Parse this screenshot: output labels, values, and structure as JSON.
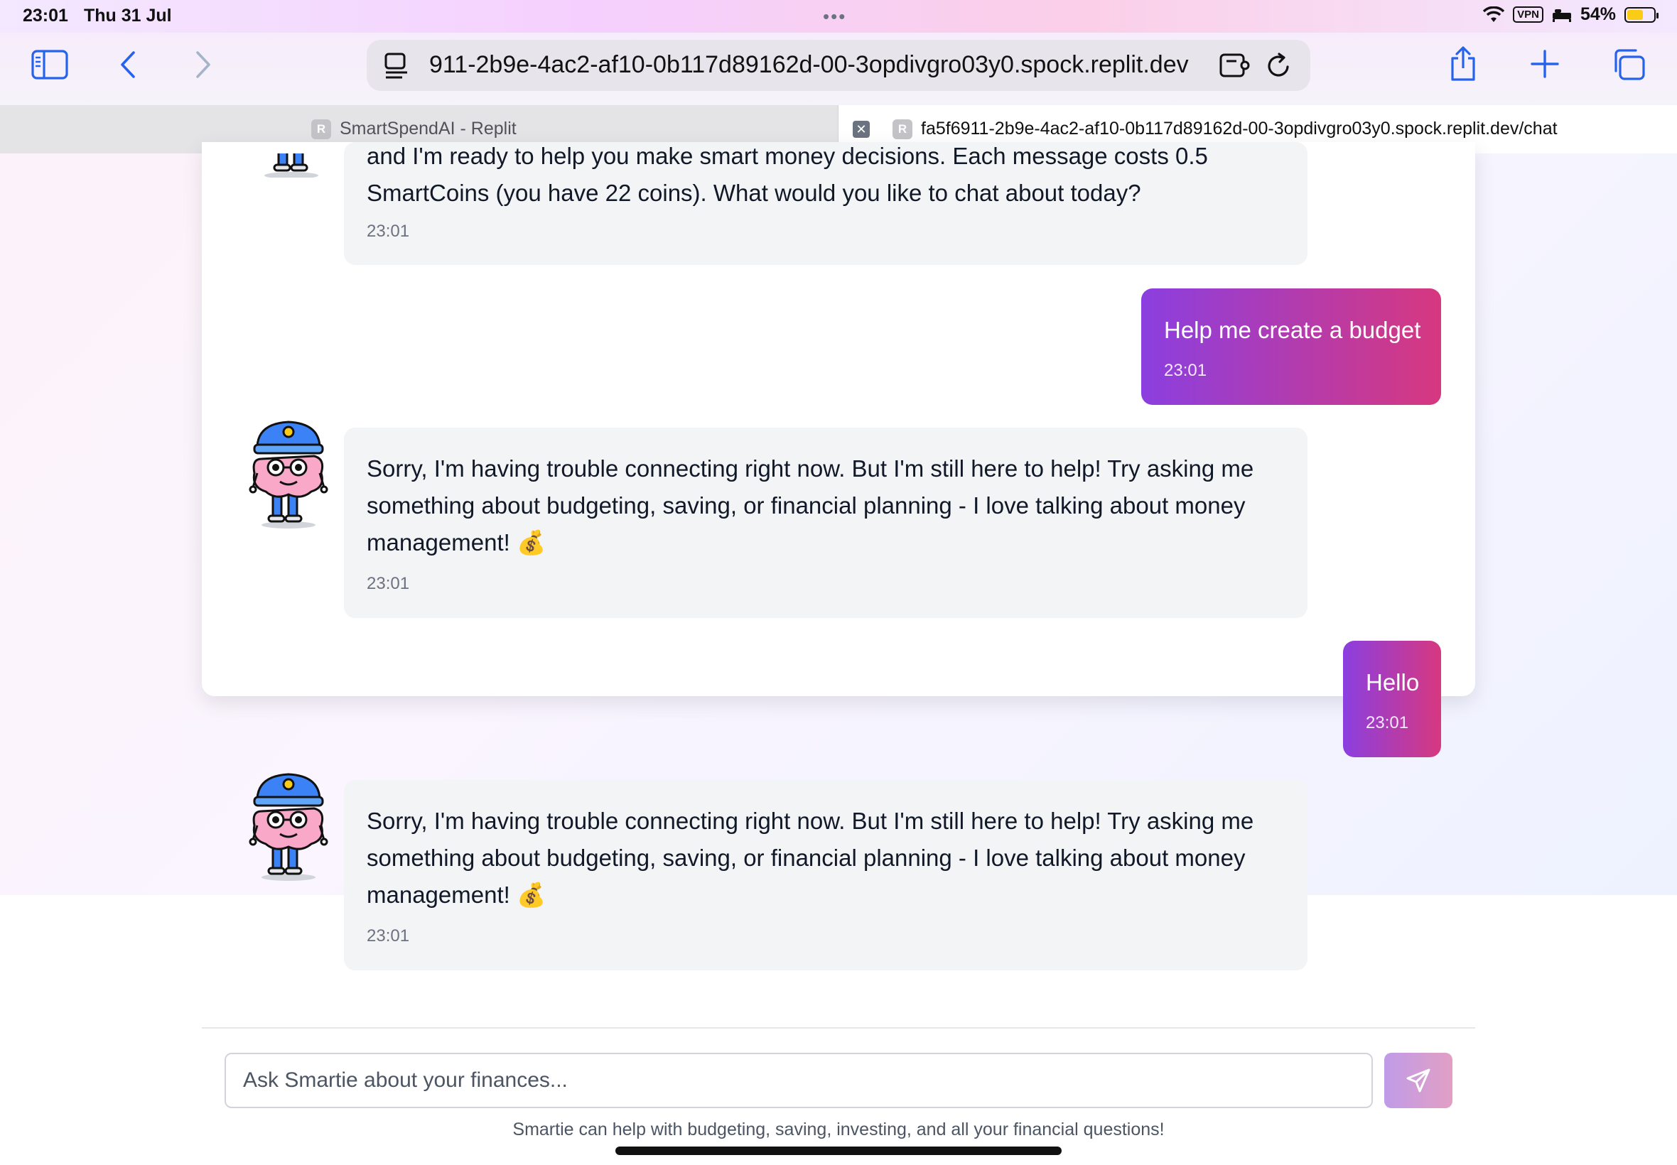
{
  "status_bar": {
    "time": "23:01",
    "date": "Thu 31 Jul",
    "vpn": "VPN",
    "battery": "54%"
  },
  "browser": {
    "address": "911-2b9e-4ac2-af10-0b117d89162d-00-3opdivgro03y0.spock.replit.dev",
    "tabs": [
      {
        "label": "SmartSpendAI - Replit",
        "favicon": "R"
      },
      {
        "label": "fa5f6911-2b9e-4ac2-af10-0b117d89162d-00-3opdivgro03y0.spock.replit.dev/chat",
        "favicon": "R"
      }
    ],
    "icons": [
      "sidebar-icon",
      "back-icon",
      "forward-icon",
      "reader-icon",
      "extension-icon",
      "reload-icon",
      "share-icon",
      "new-tab-icon",
      "tabs-overview-icon"
    ]
  },
  "messages": [
    {
      "sender": "bot",
      "line1": "and I'm ready to help you make smart money decisions. Each message costs 0.5",
      "line2": "SmartCoins (you have 22 coins). What would you like to chat about today?",
      "time": "23:01"
    },
    {
      "sender": "user",
      "text": "Help me create a budget",
      "time": "23:01"
    },
    {
      "sender": "bot",
      "line1": "Sorry, I'm having trouble connecting right now. But I'm still here to help! Try asking me",
      "line2": "something about budgeting, saving, or financial planning - I love talking about money",
      "line3": "management! 💰",
      "time": "23:01"
    },
    {
      "sender": "user",
      "text": "Hello",
      "time": "23:01"
    },
    {
      "sender": "bot",
      "line1": "Sorry, I'm having trouble connecting right now. But I'm still here to help! Try asking me",
      "line2": "something about budgeting, saving, or financial planning - I love talking about money",
      "line3": "management! 💰",
      "time": "23:01"
    }
  ],
  "composer": {
    "placeholder": "Ask Smartie about your finances...",
    "helper": "Smartie can help with budgeting, saving, investing, and all your financial questions!"
  }
}
